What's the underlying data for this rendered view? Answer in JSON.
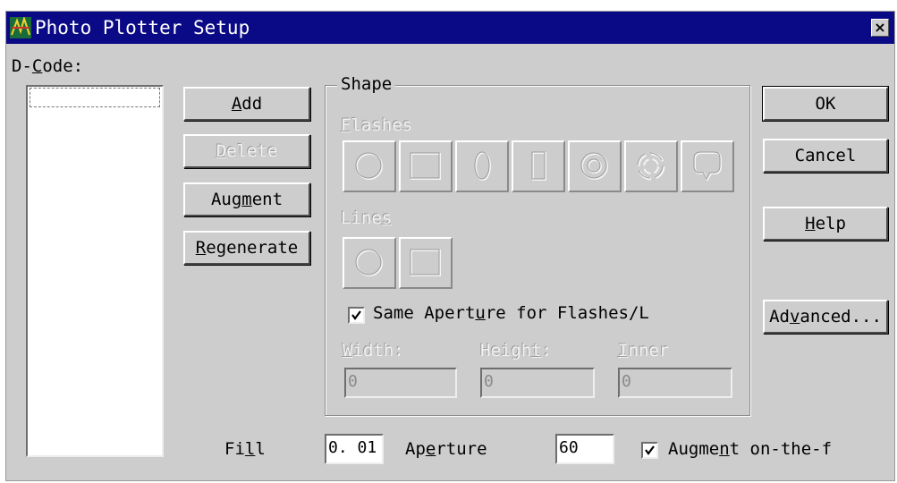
{
  "window": {
    "title": "Photo Plotter Setup",
    "close_glyph": "×",
    "icon": "app-icon"
  },
  "dcode": {
    "label_pre": "D-",
    "label_u": "C",
    "label_post": "ode:"
  },
  "left_buttons": {
    "add": {
      "u": "A",
      "rest": "dd"
    },
    "delete": {
      "u": "D",
      "rest": "elete"
    },
    "augment": {
      "pre": "Aug",
      "u": "m",
      "post": "ent"
    },
    "regenerate": {
      "u": "R",
      "rest": "egenerate"
    }
  },
  "shape": {
    "title": "Shape",
    "flashes_label_u": "F",
    "flashes_label_rest": "lashes",
    "flash_icons": [
      "circle-icon",
      "rectangle-icon",
      "oval-icon",
      "oblong-icon",
      "donut-icon",
      "thermal-icon",
      "custom-shape-icon"
    ],
    "lines_label_pre": "Line",
    "lines_label_u": "s",
    "line_icons": [
      "round-line-icon",
      "square-line-icon"
    ],
    "same_aperture": {
      "pre": "Same Apert",
      "u": "u",
      "post": "re for Flashes/L",
      "checked": true
    },
    "width": {
      "u": "W",
      "rest": "idth:",
      "value": "0"
    },
    "height": {
      "pre": "Heigh",
      "u": "t",
      "post": ":",
      "value": "0"
    },
    "inner": {
      "u": "I",
      "rest": "nner",
      "value": "0"
    }
  },
  "right_buttons": {
    "ok": "OK",
    "cancel": "Cancel",
    "help": {
      "u": "H",
      "rest": "elp"
    },
    "advanced": {
      "pre": "Ad",
      "u": "v",
      "post": "anced..."
    }
  },
  "bottom": {
    "fill": {
      "pre": "Fi",
      "u": "l",
      "post": "l",
      "value": "0. 01"
    },
    "aperture": {
      "pre": "Ap",
      "u": "e",
      "post": "rture",
      "value": "60"
    },
    "augment_otf": {
      "pre": "Augme",
      "u": "n",
      "post": "t on-the-f",
      "checked": true
    }
  },
  "colors": {
    "face": "#cdcdcd",
    "titlebar": "#0b0a86"
  }
}
